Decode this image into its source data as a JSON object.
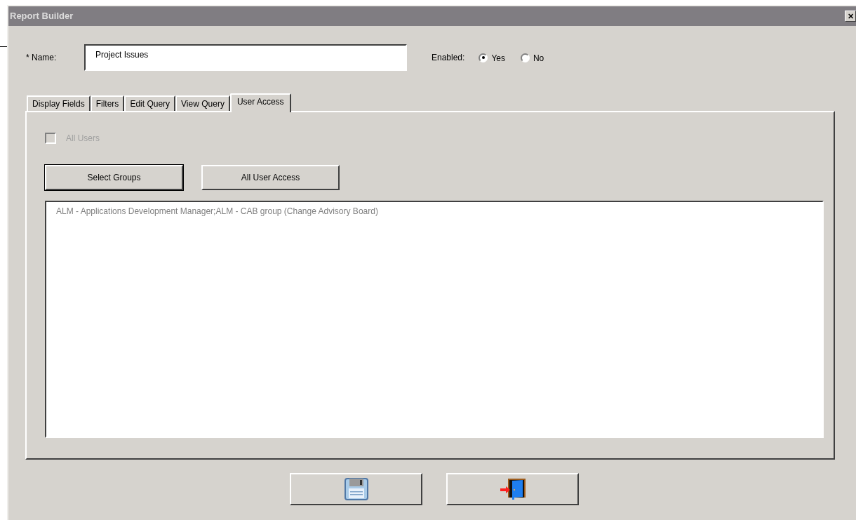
{
  "window": {
    "title": "Report Builder",
    "close": "✕"
  },
  "name_field": {
    "label": "* Name:",
    "value": "Project Issues"
  },
  "enabled": {
    "label": "Enabled:",
    "options": [
      {
        "label": "Yes",
        "selected": true
      },
      {
        "label": "No",
        "selected": false
      }
    ]
  },
  "tabs": [
    {
      "label": "Display Fields",
      "selected": false
    },
    {
      "label": "Filters",
      "selected": false
    },
    {
      "label": "Edit Query",
      "selected": false
    },
    {
      "label": "View Query",
      "selected": false
    },
    {
      "label": "User Access",
      "selected": true
    }
  ],
  "all_users": {
    "label": "All Users",
    "checked": false,
    "disabled": true
  },
  "buttons": [
    {
      "label": "Select Groups",
      "default": true
    },
    {
      "label": "All User Access",
      "default": false
    }
  ],
  "groups_text": "ALM - Applications Development Manager;ALM - CAB group (Change Advisory Board)"
}
